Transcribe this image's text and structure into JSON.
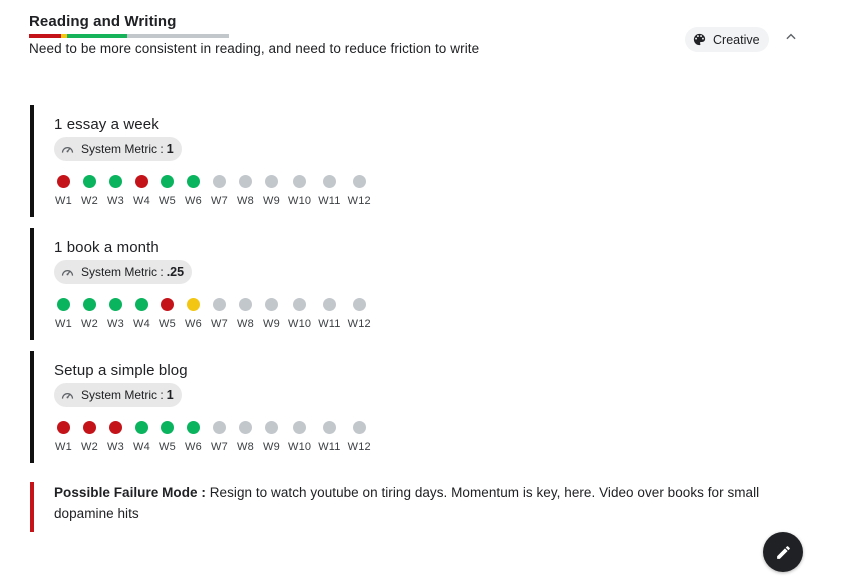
{
  "section": {
    "title": "Reading and Writing",
    "description": "Need to be more consistent in reading, and need to reduce friction to write",
    "progress_segments": [
      {
        "color": "#c5131a",
        "fraction": 0.16
      },
      {
        "color": "#f3c613",
        "fraction": 0.03
      },
      {
        "color": "#16b35a",
        "fraction": 0.3
      },
      {
        "color": "#c2c7cc",
        "fraction": 0.51
      }
    ],
    "category_chip": {
      "label": "Creative",
      "icon": "palette-icon"
    },
    "collapse_icon": "chevron-up-icon"
  },
  "colors": {
    "red": "#c5131a",
    "green": "#0ab45e",
    "yellow": "#f3c613",
    "grey": "#c2c7cc",
    "goal_border": "#111111",
    "failure_border": "#c5131a"
  },
  "goals": [
    {
      "title": "1 essay a week",
      "metric_label": "System Metric :",
      "metric_value": "1",
      "weeks": [
        {
          "label": "W1",
          "status": "red"
        },
        {
          "label": "W2",
          "status": "green"
        },
        {
          "label": "W3",
          "status": "green"
        },
        {
          "label": "W4",
          "status": "red"
        },
        {
          "label": "W5",
          "status": "green"
        },
        {
          "label": "W6",
          "status": "green"
        },
        {
          "label": "W7",
          "status": "grey"
        },
        {
          "label": "W8",
          "status": "grey"
        },
        {
          "label": "W9",
          "status": "grey"
        },
        {
          "label": "W10",
          "status": "grey"
        },
        {
          "label": "W11",
          "status": "grey"
        },
        {
          "label": "W12",
          "status": "grey"
        }
      ]
    },
    {
      "title": "1 book a month",
      "metric_label": "System Metric :",
      "metric_value": ".25",
      "weeks": [
        {
          "label": "W1",
          "status": "green"
        },
        {
          "label": "W2",
          "status": "green"
        },
        {
          "label": "W3",
          "status": "green"
        },
        {
          "label": "W4",
          "status": "green"
        },
        {
          "label": "W5",
          "status": "red"
        },
        {
          "label": "W6",
          "status": "yellow"
        },
        {
          "label": "W7",
          "status": "grey"
        },
        {
          "label": "W8",
          "status": "grey"
        },
        {
          "label": "W9",
          "status": "grey"
        },
        {
          "label": "W10",
          "status": "grey"
        },
        {
          "label": "W11",
          "status": "grey"
        },
        {
          "label": "W12",
          "status": "grey"
        }
      ]
    },
    {
      "title": "Setup a simple blog",
      "metric_label": "System Metric :",
      "metric_value": "1",
      "weeks": [
        {
          "label": "W1",
          "status": "red"
        },
        {
          "label": "W2",
          "status": "red"
        },
        {
          "label": "W3",
          "status": "red"
        },
        {
          "label": "W4",
          "status": "green"
        },
        {
          "label": "W5",
          "status": "green"
        },
        {
          "label": "W6",
          "status": "green"
        },
        {
          "label": "W7",
          "status": "grey"
        },
        {
          "label": "W8",
          "status": "grey"
        },
        {
          "label": "W9",
          "status": "grey"
        },
        {
          "label": "W10",
          "status": "grey"
        },
        {
          "label": "W11",
          "status": "grey"
        },
        {
          "label": "W12",
          "status": "grey"
        }
      ]
    }
  ],
  "failure_mode": {
    "label": "Possible Failure Mode :",
    "text": "Resign to watch youtube on tiring days. Momentum is key, here. Video over books for small dopamine hits"
  },
  "fab": {
    "icon": "pencil-icon"
  }
}
